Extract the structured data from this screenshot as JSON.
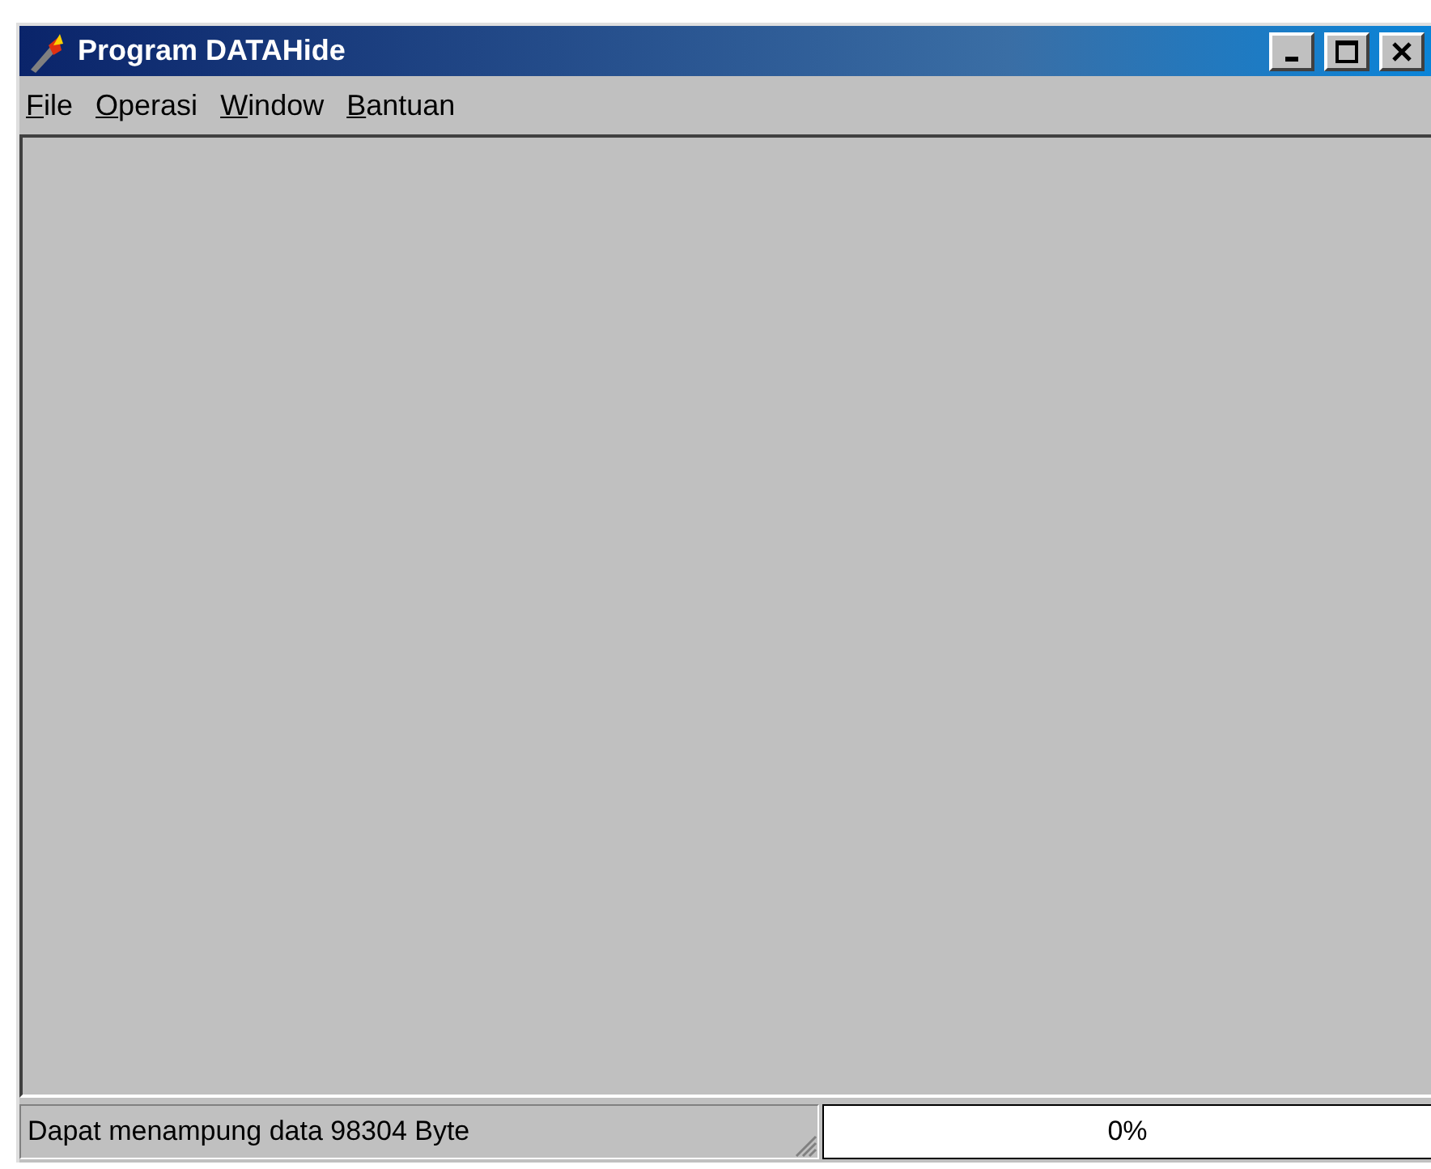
{
  "window": {
    "title": "Program DATAHide"
  },
  "menu": [
    {
      "label": "File"
    },
    {
      "label": "Operasi"
    },
    {
      "label": "Window"
    },
    {
      "label": "Bantuan"
    }
  ],
  "status_bar": {
    "message": "Dapat menampung data 98304 Byte",
    "progress": {
      "level": 0,
      "reading": "0%"
    }
  }
}
